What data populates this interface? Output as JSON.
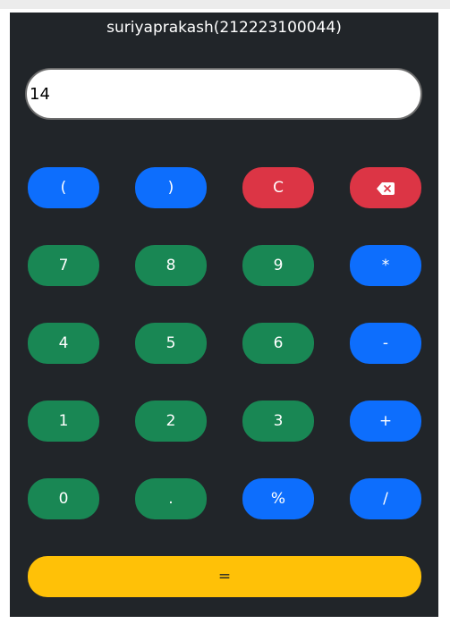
{
  "window": {
    "title": "suriyaprakash(212223100044)"
  },
  "display": {
    "value": "14"
  },
  "buttons": {
    "open_paren": "(",
    "close_paren": ")",
    "clear": "C",
    "backspace_icon": "backspace-icon",
    "seven": "7",
    "eight": "8",
    "nine": "9",
    "multiply": "*",
    "four": "4",
    "five": "5",
    "six": "6",
    "subtract": "-",
    "one": "1",
    "two": "2",
    "three": "3",
    "add": "+",
    "zero": "0",
    "decimal": ".",
    "percent": "%",
    "divide": "/",
    "equals": "="
  },
  "colors": {
    "background": "#212529",
    "blue": "#0d6efd",
    "green": "#198754",
    "red": "#dc3545",
    "yellow": "#ffc107"
  }
}
